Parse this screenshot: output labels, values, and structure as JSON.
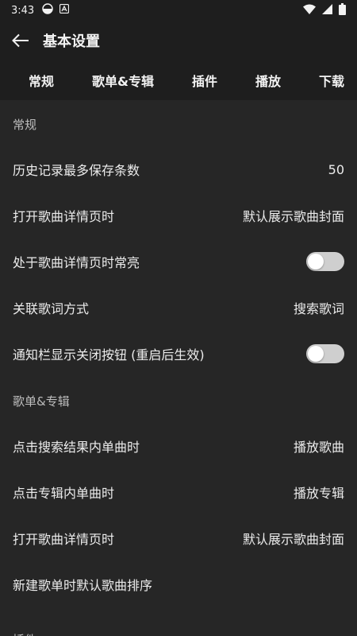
{
  "status_bar": {
    "time": "3:43",
    "left_icons": [
      "theme-toggle-icon",
      "notification-a-icon"
    ],
    "right_icons": [
      "wifi-icon",
      "signal-icon",
      "battery-icon"
    ]
  },
  "app_bar": {
    "title": "基本设置",
    "back_icon": "arrow-left-icon"
  },
  "tabs": [
    {
      "label": "常规"
    },
    {
      "label": "歌单&专辑"
    },
    {
      "label": "插件"
    },
    {
      "label": "播放"
    },
    {
      "label": "下载"
    }
  ],
  "sections": [
    {
      "title": "常规",
      "items": [
        {
          "label": "历史记录最多保存条数",
          "value": "50"
        },
        {
          "label": "打开歌曲详情页时",
          "value": "默认展示歌曲封面"
        },
        {
          "label": "处于歌曲详情页时常亮",
          "switch": false
        },
        {
          "label": "关联歌词方式",
          "value": "搜索歌词"
        },
        {
          "label": "通知栏显示关闭按钮 (重启后生效)",
          "switch": false
        }
      ]
    },
    {
      "title": "歌单&专辑",
      "items": [
        {
          "label": "点击搜索结果内单曲时",
          "value": "播放歌曲"
        },
        {
          "label": "点击专辑内单曲时",
          "value": "播放专辑"
        },
        {
          "label": "打开歌曲详情页时",
          "value": "默认展示歌曲封面"
        },
        {
          "label": "新建歌单时默认歌曲排序",
          "value": ""
        }
      ]
    },
    {
      "title": "插件",
      "items": []
    }
  ],
  "colors": {
    "background": "#262626",
    "bar": "#1e1e1e",
    "text": "#ececec",
    "section_title": "#bdbdbd",
    "switch_track_off": "#cfcfcf",
    "switch_knob": "#ffffff"
  }
}
